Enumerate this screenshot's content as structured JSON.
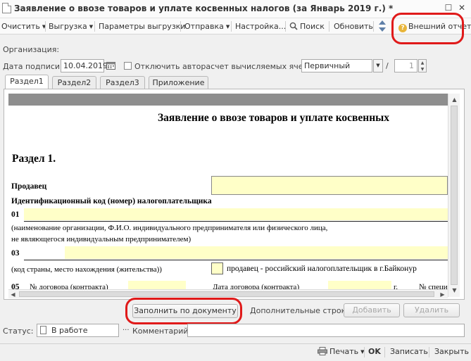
{
  "window": {
    "title": "Заявление о ввозе товаров и уплате косвенных налогов (за Январь 2019 г.) *"
  },
  "toolbar": {
    "clear": "Очистить",
    "export": "Выгрузка",
    "export_params": "Параметры выгрузки",
    "send": "Отправка",
    "settings": "Настройка...",
    "search": "Поиск",
    "refresh": "Обновить",
    "external_report": "Внешний отчет"
  },
  "form": {
    "organization_label": "Организация:",
    "sign_date_label": "Дата подписи:",
    "sign_date": "10.04.2019",
    "disable_autocalc_label": "Отключить авторасчет вычисляемых ячеек",
    "report_kind": "Первичный",
    "slash": "/",
    "correction_number": "1"
  },
  "tabs": [
    "Раздел1",
    "Раздел2",
    "Раздел3",
    "Приложение"
  ],
  "sheet": {
    "heading": "Заявление о ввозе товаров и уплате косвенных",
    "section": "Раздел 1.",
    "seller": "Продавец",
    "inn_label": "Идентификационный код (номер) налогоплательщика",
    "row01": "01",
    "row01_note_1": "(наименование организации, Ф.И.О. индивидуального предпринимателя или физического лица,",
    "row01_note_2": "не являющегося индивидуальным предпринимателем)",
    "row03": "03",
    "row03_note": "(код страны, место нахождения (жительства))",
    "baikonur_label": "продавец - российский налогоплательщик в г.Байконур",
    "row05": "05",
    "contract_no": "№ договора (контракта)",
    "contract_date": "Дата договора (контракта)",
    "g_suffix": "г.",
    "spec_no": "№ специ"
  },
  "actions": {
    "fill_by_document": "Заполнить по документу",
    "additional_rows_label": "Дополнительные строки:",
    "add": "Добавить",
    "delete": "Удалить"
  },
  "status": {
    "label": "Статус:",
    "value": "В работе",
    "comment_label": "Комментарий:"
  },
  "bottom": {
    "print": "Печать",
    "ok": "OK",
    "record": "Записать",
    "close": "Закрыть"
  }
}
